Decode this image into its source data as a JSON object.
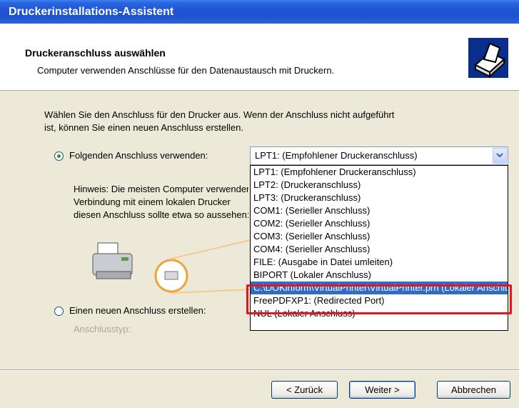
{
  "window": {
    "title": "Druckerinstallations-Assistent"
  },
  "header": {
    "title": "Druckeranschluss auswählen",
    "subtitle": "Computer verwenden Anschlüsse für den Datenaustausch mit Druckern."
  },
  "intro": {
    "line1": "Wählen Sie den Anschluss für den Drucker aus. Wenn der Anschluss nicht aufgeführt",
    "line2": "ist, können Sie einen neuen Anschluss erstellen."
  },
  "option_existing": {
    "label": "Folgenden Anschluss verwenden:",
    "selected": true
  },
  "port_combo": {
    "value": "LPT1: (Empfohlener Druckeranschluss)",
    "options": [
      "LPT1: (Empfohlener Druckeranschluss)",
      "LPT2: (Druckeranschluss)",
      "LPT3: (Druckeranschluss)",
      "COM1: (Serieller Anschluss)",
      "COM2: (Serieller Anschluss)",
      "COM3: (Serieller Anschluss)",
      "COM4: (Serieller Anschluss)",
      "FILE: (Ausgabe in Datei umleiten)",
      "BIPORT (Lokaler Anschluss)",
      "C:\\DOKinform\\VirtualPrinter\\VirtualPrinter.prn (Lokaler Anschluss)",
      "FreePDFXP1: (Redirected Port)",
      "NUL (Lokaler Anschluss)"
    ],
    "highlighted_index": 9
  },
  "hint": {
    "line1": "Hinweis: Die meisten Computer verwenden",
    "line2": "Verbindung mit einem lokalen Drucker",
    "line3": "diesen Anschluss sollte etwa so aussehen:"
  },
  "option_new": {
    "label": "Einen neuen Anschluss erstellen:",
    "selected": false
  },
  "port_type_label": "Anschlusstyp:",
  "buttons": {
    "back": "< Zurück",
    "next": "Weiter >",
    "cancel": "Abbrechen"
  },
  "colors": {
    "titlebar": "#1f56d4",
    "selection": "#316ac5",
    "callout": "#e6141b",
    "background": "#ece9d8"
  }
}
